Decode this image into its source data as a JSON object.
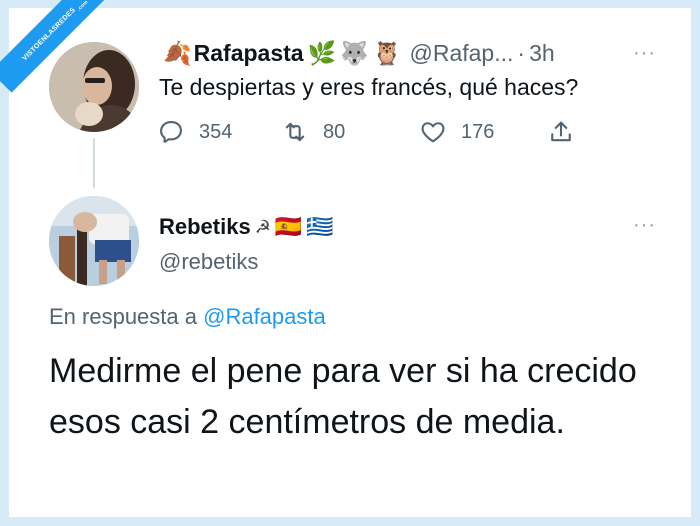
{
  "watermark": {
    "text": "VISTOENLASREDES",
    "sub": ".com"
  },
  "tweet1": {
    "name": "Rafapasta",
    "name_emoji_prefix": "🍂",
    "name_emoji_suffix": [
      "🌿",
      "🐺",
      "🦉"
    ],
    "handle": "@Rafap...",
    "separator": "·",
    "time": "3h",
    "more": "···",
    "text": "Te despiertas y eres francés, qué haces?",
    "replies": "354",
    "retweets": "80",
    "likes": "176"
  },
  "tweet2": {
    "name": "Rebetiks",
    "name_emojis": [
      "☭",
      "🇪🇸",
      "🇬🇷"
    ],
    "handle": "@rebetiks",
    "more": "···",
    "reply_prefix": "En respuesta a",
    "reply_to": "@Rafapasta",
    "text": "Medirme el pene para ver si ha crecido esos casi 2 centímetros de media."
  },
  "icons": {
    "reply": "reply-icon",
    "retweet": "retweet-icon",
    "like": "heart-icon",
    "share": "share-icon"
  },
  "colors": {
    "background": "#d6ebf7",
    "text": "#0f1419",
    "secondary": "#536471",
    "link": "#1d9bf0"
  }
}
